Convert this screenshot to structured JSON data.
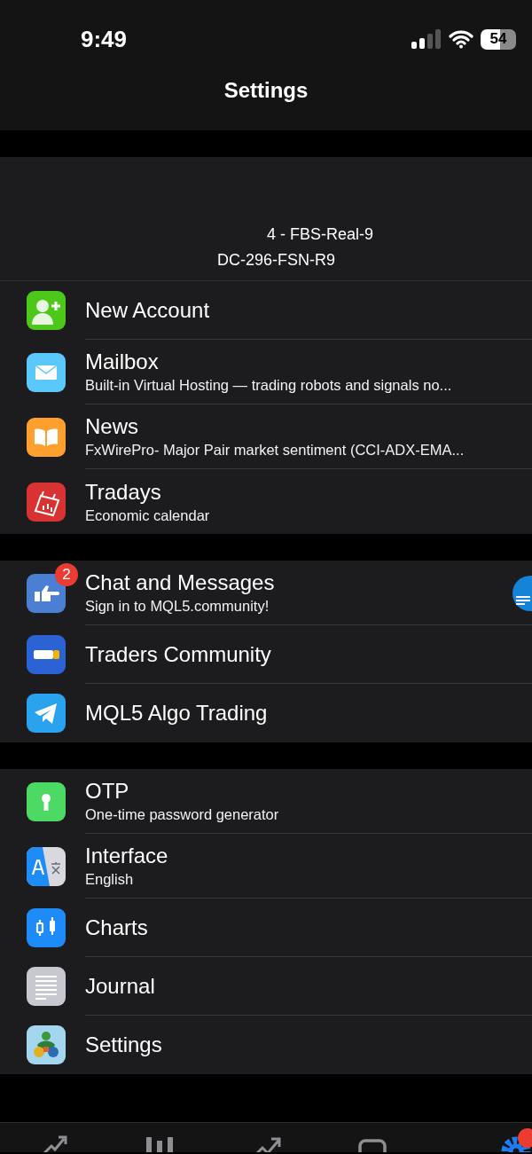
{
  "status_bar": {
    "time": "9:49",
    "battery": "54"
  },
  "nav_bar": {
    "title": "Settings"
  },
  "account": {
    "name": "4 - FBS-Real-9",
    "server": "DC-296-FSN-R9"
  },
  "sections": [
    {
      "rows": [
        {
          "title": "New Account"
        },
        {
          "title": "Mailbox",
          "subtitle": "Built-in Virtual Hosting — trading robots and signals no..."
        },
        {
          "title": "News",
          "subtitle": "FxWirePro- Major Pair market sentiment (CCI-ADX-EMA..."
        },
        {
          "title": "Tradays",
          "subtitle": "Economic calendar"
        }
      ]
    },
    {
      "rows": [
        {
          "title": "Chat and Messages",
          "subtitle": "Sign in to MQL5.community!",
          "badge": "2"
        },
        {
          "title": "Traders Community"
        },
        {
          "title": "MQL5 Algo Trading"
        }
      ]
    },
    {
      "rows": [
        {
          "title": "OTP",
          "subtitle": "One-time password generator"
        },
        {
          "title": "Interface",
          "subtitle": "English"
        },
        {
          "title": "Charts"
        },
        {
          "title": "Journal"
        },
        {
          "title": "Settings"
        }
      ]
    }
  ],
  "tab_bar": {
    "tabs": [
      {
        "selected": false
      },
      {
        "selected": false
      },
      {
        "selected": false
      },
      {
        "selected": false
      },
      {
        "selected": true
      }
    ]
  }
}
